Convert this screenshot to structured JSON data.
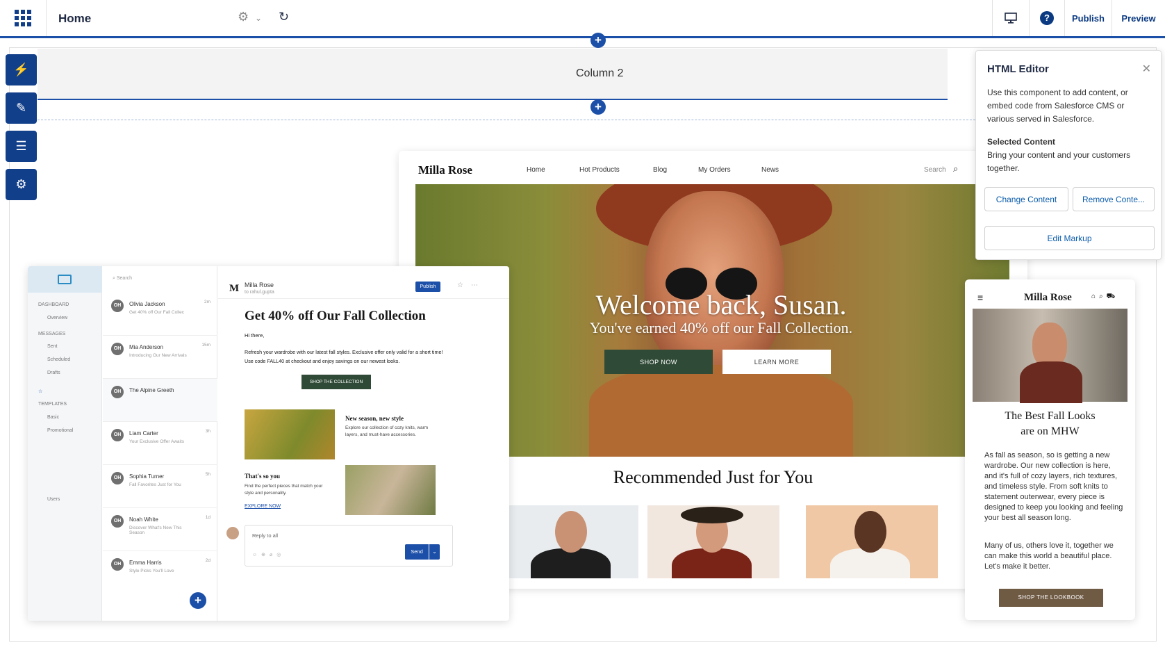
{
  "app": {
    "title": "Home",
    "publish": "Publish",
    "preview": "Preview"
  },
  "builder": {
    "column_label": "Column 2"
  },
  "site": {
    "brand": "Milla Rose",
    "nav": [
      "Home",
      "Hot Products",
      "Blog",
      "My Orders",
      "News"
    ],
    "search": "Search",
    "hero_title": "Welcome back, Susan.",
    "hero_sub": "You've earned 40% off our Fall Collection.",
    "shop_now": "SHOP NOW",
    "learn_more": "LEARN MORE",
    "recommended": "Recommended Just for You"
  },
  "mail": {
    "search": "Search",
    "rail": {
      "dashboard": "DASHBOARD",
      "overview": "Overview",
      "messages": "MESSAGES",
      "sent": "Sent",
      "scheduled": "Scheduled",
      "drafts": "Drafts",
      "templates": "TEMPLATES",
      "basic": "Basic",
      "promotional": "Promotional",
      "users": "Users"
    },
    "items": [
      {
        "initials": "OH",
        "name": "Olivia Jackson",
        "subject": "Get 40% off Our Fall Collec",
        "time": "2m"
      },
      {
        "initials": "OH",
        "name": "Mia Anderson",
        "subject": "Introducing Our New Arrivals",
        "time": "15m"
      },
      {
        "initials": "OH",
        "name": "The Alpine Greeth",
        "subject": "",
        "time": ""
      },
      {
        "initials": "OH",
        "name": "Liam Carter",
        "subject": "Your Exclusive Offer Awaits",
        "time": "3h"
      },
      {
        "initials": "OH",
        "name": "Sophia Turner",
        "subject": "Fall Favorites Just for You",
        "time": "5h"
      },
      {
        "initials": "OH",
        "name": "Noah White",
        "subject": "Discover What's New This Season",
        "time": "1d"
      },
      {
        "initials": "OH",
        "name": "Emma Harris",
        "subject": "Style Picks You'll Love",
        "time": "2d"
      }
    ],
    "sender": "Milla Rose",
    "to": "to rahul.gupta",
    "publish": "Publish",
    "headline": "Get 40% off Our Fall Collection",
    "greeting": "Hi there,",
    "body1": "Refresh your wardrobe with our latest fall styles. Exclusive offer only valid for a short time!",
    "body2": "Use code FALL40 at checkout and enjoy savings on our newest looks.",
    "cta": "SHOP THE COLLECTION",
    "block1_title": "New season, new style",
    "block1_text": "Explore our collection of cozy knits, warm layers, and must-have accessories.",
    "block2_title": "That's so you",
    "block2_text": "Find the perfect pieces that match your style and personality.",
    "explore": "EXPLORE NOW",
    "reply": "Reply to all",
    "send": "Send"
  },
  "mobile": {
    "brand": "Milla Rose",
    "title_l1": "The Best Fall Looks",
    "title_l2": "are on MHW",
    "p1": "As fall as season, so is getting a new wardrobe. Our new collection is here, and it's full of cozy layers, rich textures, and timeless style. From soft knits to statement outerwear, every piece is designed to keep you looking and feeling your best all season long.",
    "p2": "Many of us, others love it, together we can make this world a beautiful place. Let's make it better.",
    "cta": "SHOP THE LOOKBOOK"
  },
  "editor": {
    "title": "HTML Editor",
    "desc": "Use this component to add content, or embed code from Salesforce CMS or various served in Salesforce.",
    "selected_label": "Selected Content",
    "selected_desc": "Bring your content and your customers together.",
    "change": "Change Content",
    "remove": "Remove Conte...",
    "edit_markup": "Edit Markup"
  },
  "colors": {
    "brand_blue": "#1b4fa8",
    "dark_navy": "#123f8a",
    "forest_green": "#2f4a36",
    "mobile_cta": "#6f5a44"
  }
}
